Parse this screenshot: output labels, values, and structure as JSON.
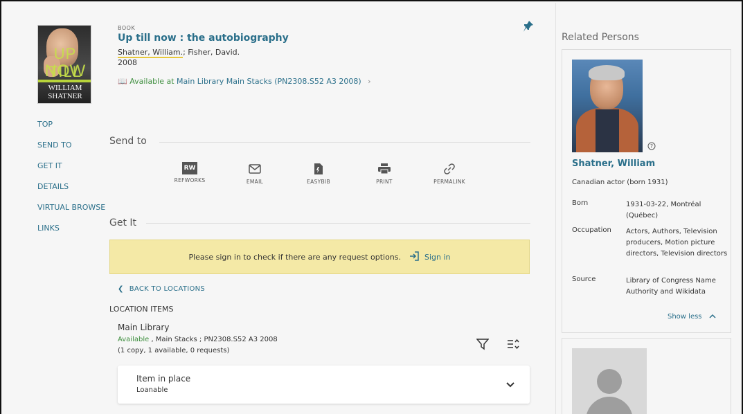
{
  "record": {
    "type": "BOOK",
    "title": "Up till now : the autobiography",
    "author_1": "Shatner, William.",
    "author_sep": "; ",
    "author_2": "Fisher, David.",
    "year": "2008",
    "availability_status": "Available at",
    "availability_location": "Main Library  Main Stacks (PN2308.S52 A3 2008)",
    "cover": {
      "text_1": "UP TILL",
      "text_2": "NOW",
      "name_1": "WILLIAM",
      "name_2": "SHATNER"
    }
  },
  "leftnav": [
    "TOP",
    "SEND TO",
    "GET IT",
    "DETAILS",
    "VIRTUAL BROWSE",
    "LINKS"
  ],
  "send_to": {
    "heading": "Send to",
    "actions": [
      {
        "label": "REFWORKS",
        "icon": "refworks-icon"
      },
      {
        "label": "EMAIL",
        "icon": "email-icon"
      },
      {
        "label": "EASYBIB",
        "icon": "easybib-icon"
      },
      {
        "label": "PRINT",
        "icon": "print-icon"
      },
      {
        "label": "PERMALINK",
        "icon": "permalink-icon"
      }
    ],
    "refworks_badge": "RW"
  },
  "get_it": {
    "heading": "Get It",
    "signin_message": "Please sign in to check if there are any request options.",
    "signin_link": "Sign in",
    "back_label": "BACK TO LOCATIONS",
    "location_items_label": "LOCATION ITEMS",
    "library": "Main Library",
    "status": "Available",
    "shelf": " , Main Stacks ; PN2308.S52 A3 2008",
    "counts": "(1 copy, 1 available, 0 requests)",
    "item_status": "Item in place",
    "item_policy": "Loanable"
  },
  "related": {
    "heading": "Related Persons",
    "person_name": "Shatner, William",
    "person_desc": "Canadian actor (born 1931)",
    "born_label": "Born",
    "born_value": "1931-03-22, Montréal (Québec)",
    "occupation_label": "Occupation",
    "occupation_value": "Actors, Authors, Television producers, Motion picture directors, Television directors",
    "source_label": "Source",
    "source_value": "Library of Congress Name Authority and Wikidata",
    "show_less": "Show less"
  },
  "colors": {
    "link": "#2a6f8a",
    "available": "#3f8f3f",
    "signin_bg": "#f4e9a6"
  }
}
